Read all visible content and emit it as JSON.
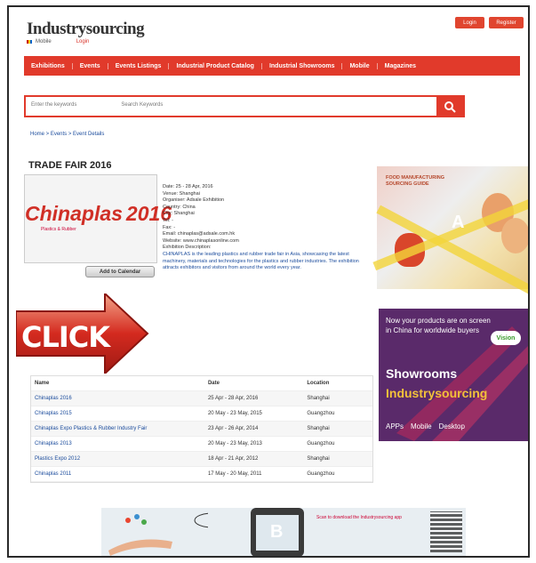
{
  "header": {
    "logo": "Industrysourcing",
    "logo_sub_left": "Mobile",
    "logo_sub_right": "Login",
    "top_buttons": [
      "Login",
      "Register"
    ]
  },
  "nav": {
    "items": [
      "Exhibitions",
      "Events",
      "Events Listings",
      "Industrial Product Catalog",
      "Industrial Showrooms",
      "Mobile",
      "Magazines"
    ]
  },
  "search": {
    "placeholder_left": "Enter the keywords",
    "placeholder_right": "Search Keywords",
    "button_icon": "search-icon"
  },
  "breadcrumb": "Home > Events > Event Details",
  "page": {
    "title": "TRADE FAIR 2016",
    "event_logo": "Chinaplas",
    "event_logo_year": "2016",
    "event_logo_sub": "Plastics & Rubber",
    "add_calendar_label": "Add to Calendar"
  },
  "details": {
    "lines": [
      "Date: 25 - 28 Apr, 2016",
      "Venue: Shanghai",
      "Organiser: Adsale Exhibition",
      "Country: China",
      "City: Shanghai",
      "Tel: -",
      "Fax: -",
      "Email: chinaplas@adsale.com.hk",
      "Website: www.chinaplasonline.com",
      "Exhibition Description:"
    ],
    "description": "CHINAPLAS is the leading plastics and rubber trade fair in Asia, showcasing the latest machinery, materials and technologies for the plastics and rubber industries. The exhibition attracts exhibitors and visitors from around the world every year."
  },
  "ads": {
    "a": {
      "headline": "FOOD MANUFACTURING SOURCING GUIDE",
      "letter": "A"
    },
    "right": {
      "top_text": "Now your products are on screen in China for worldwide buyers",
      "badge": "Vision",
      "line1": "Showrooms",
      "line2": "Industrysourcing",
      "bottom": [
        "APPs",
        "Mobile",
        "Desktop"
      ]
    },
    "b": {
      "letter": "B",
      "text": "Scan to download the Industrysourcing app"
    }
  },
  "click_label": "CLICK",
  "table": {
    "headers": [
      "Name",
      "Date",
      "Location"
    ],
    "rows": [
      [
        "Chinaplas 2016",
        "25 Apr - 28 Apr, 2016",
        "Shanghai"
      ],
      [
        "Chinaplas 2015",
        "20 May - 23 May, 2015",
        "Guangzhou"
      ],
      [
        "Chinaplas Expo Plastics & Rubber Industry Fair",
        "23 Apr - 26 Apr, 2014",
        "Shanghai"
      ],
      [
        "Chinaplas 2013",
        "20 May - 23 May, 2013",
        "Guangzhou"
      ],
      [
        "Plastics Expo 2012",
        "18 Apr - 21 Apr, 2012",
        "Shanghai"
      ],
      [
        "Chinaplas 2011",
        "17 May - 20 May, 2011",
        "Guangzhou"
      ]
    ]
  },
  "colors": {
    "brand_red": "#e13a2b",
    "link_blue": "#1a4b9c",
    "ad_purple": "#5a2a6a"
  }
}
